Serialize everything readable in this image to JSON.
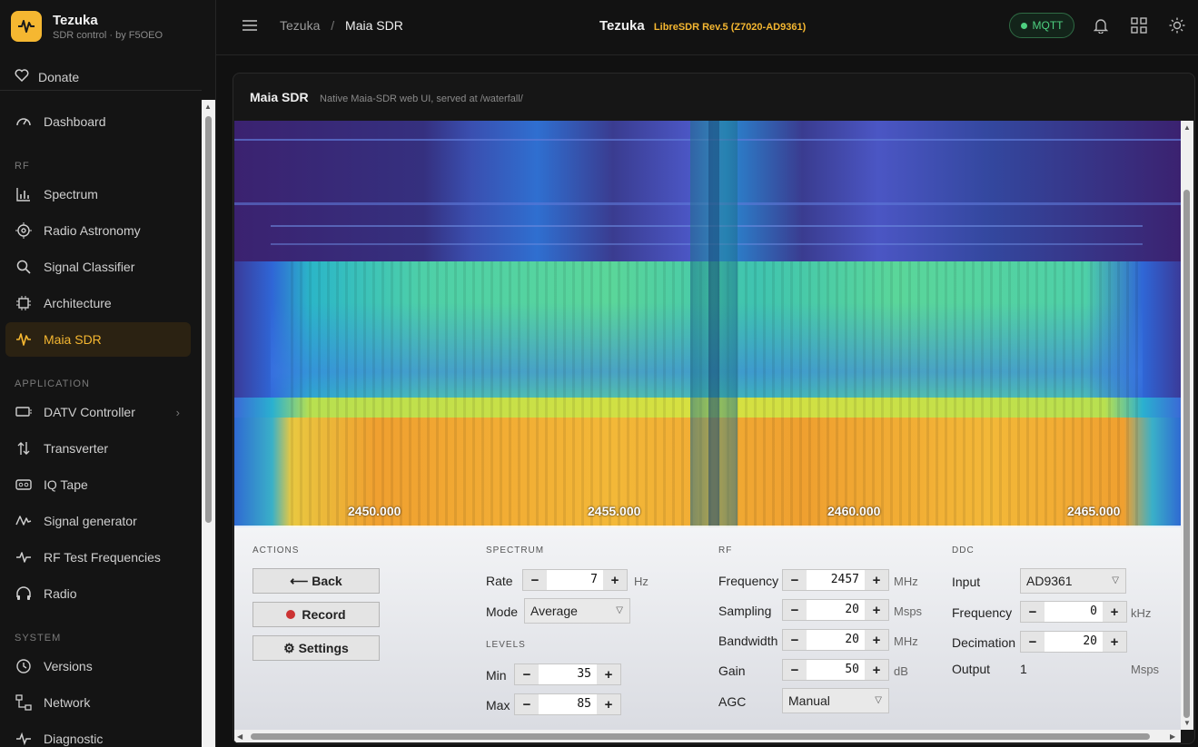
{
  "brand": {
    "title": "Tezuka",
    "subtitle": "SDR control · by F5OEO",
    "accent": "#f5b731"
  },
  "donate": {
    "label": "Donate"
  },
  "nav": {
    "dashboard": "Dashboard",
    "section_rf": "RF",
    "spectrum": "Spectrum",
    "radio_astronomy": "Radio Astronomy",
    "signal_classifier": "Signal Classifier",
    "architecture": "Architecture",
    "maia_sdr": "Maia SDR",
    "section_application": "APPLICATION",
    "datv_controller": "DATV Controller",
    "transverter": "Transverter",
    "iq_tape": "IQ Tape",
    "signal_generator": "Signal generator",
    "rf_test_frequencies": "RF Test Frequencies",
    "radio": "Radio",
    "section_system": "SYSTEM",
    "versions": "Versions",
    "network": "Network",
    "diagnostic": "Diagnostic"
  },
  "topbar": {
    "breadcrumb_root": "Tezuka",
    "breadcrumb_sep": "/",
    "breadcrumb_current": "Maia SDR",
    "title": "Tezuka",
    "device": "LibreSDR Rev.5 (Z7020-AD9361)",
    "mqtt_label": "MQTT",
    "mqtt_color": "#4ed080"
  },
  "card": {
    "title": "Maia SDR",
    "subtitle": "Native Maia-SDR web UI, served at /waterfall/"
  },
  "waterfall": {
    "freq_labels": [
      "2450.000",
      "2455.000",
      "2460.000",
      "2465.000"
    ]
  },
  "controls": {
    "actions": {
      "title": "ACTIONS",
      "back": "⟵ Back",
      "record": "Record",
      "settings": "⚙ Settings"
    },
    "spectrum": {
      "title": "SPECTRUM",
      "rate_label": "Rate",
      "rate_value": "7",
      "rate_unit": "Hz",
      "mode_label": "Mode",
      "mode_value": "Average"
    },
    "levels": {
      "title": "LEVELS",
      "min_label": "Min",
      "min_value": "35",
      "max_label": "Max",
      "max_value": "85"
    },
    "rf": {
      "title": "RF",
      "frequency_label": "Frequency",
      "frequency_value": "2457",
      "frequency_unit": "MHz",
      "sampling_label": "Sampling",
      "sampling_value": "20",
      "sampling_unit": "Msps",
      "bandwidth_label": "Bandwidth",
      "bandwidth_value": "20",
      "bandwidth_unit": "MHz",
      "gain_label": "Gain",
      "gain_value": "50",
      "gain_unit": "dB",
      "agc_label": "AGC",
      "agc_value": "Manual"
    },
    "ddc": {
      "title": "DDC",
      "input_label": "Input",
      "input_value": "AD9361",
      "frequency_label": "Frequency",
      "frequency_value": "0",
      "frequency_unit": "kHz",
      "decimation_label": "Decimation",
      "decimation_value": "20",
      "output_label": "Output",
      "output_value": "1",
      "output_unit": "Msps"
    },
    "stepper": {
      "minus": "−",
      "plus": "+"
    }
  }
}
